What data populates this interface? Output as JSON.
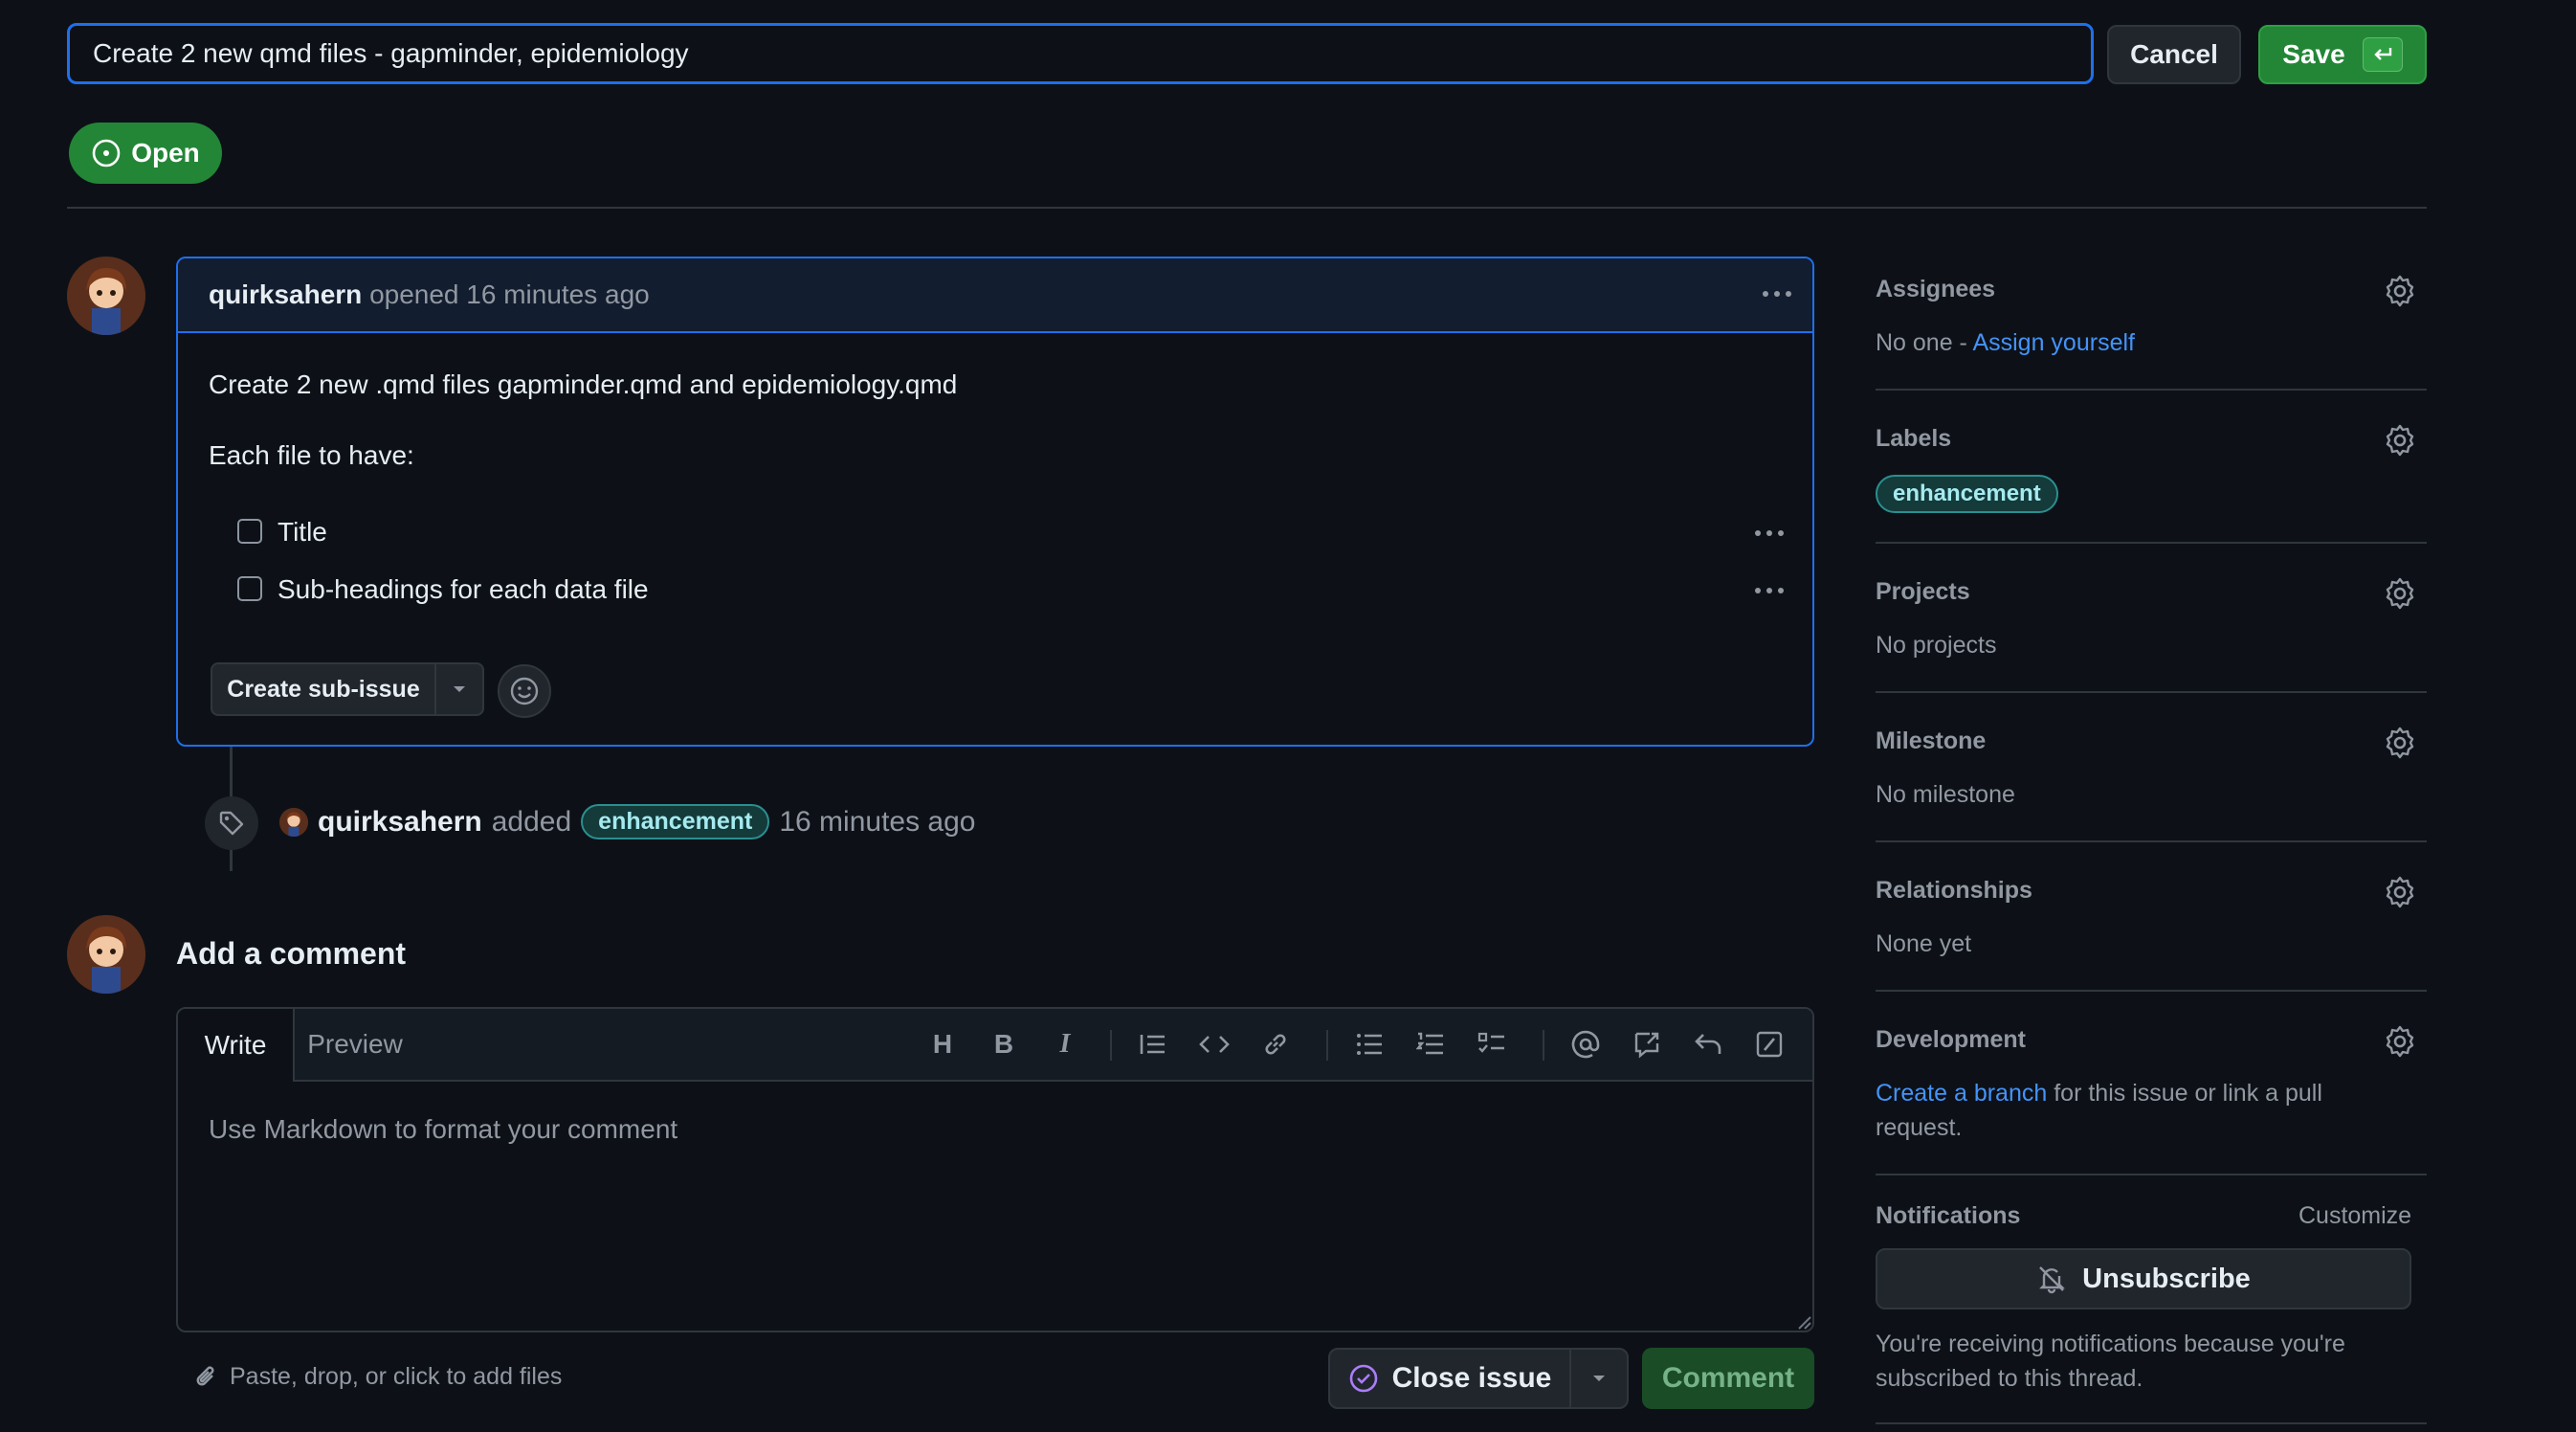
{
  "title_edit": {
    "value": "Create 2 new qmd files - gapminder, epidemiology",
    "cancel_label": "Cancel",
    "save_label": "Save"
  },
  "state": {
    "label": "Open"
  },
  "issue": {
    "author": "quirksahern",
    "opened_text": "opened 16 minutes ago",
    "body_line1": "Create 2 new .qmd files gapminder.qmd and epidemiology.qmd",
    "body_line2": "Each file to have:",
    "tasks": [
      "Title",
      "Sub-headings for each data file"
    ],
    "create_sub_issue_label": "Create sub-issue"
  },
  "timeline": {
    "user": "quirksahern",
    "action": "added",
    "label": "enhancement",
    "time": "16 minutes ago"
  },
  "add_comment": {
    "heading": "Add a comment",
    "tab_write": "Write",
    "tab_preview": "Preview",
    "placeholder": "Use Markdown to format your comment",
    "attach_text": "Paste, drop, or click to add files",
    "close_issue_label": "Close issue",
    "comment_label": "Comment"
  },
  "sidebar": {
    "assignees": {
      "heading": "Assignees",
      "value_prefix": "No one - ",
      "link": "Assign yourself"
    },
    "labels": {
      "heading": "Labels",
      "value": "enhancement"
    },
    "projects": {
      "heading": "Projects",
      "value": "No projects"
    },
    "milestone": {
      "heading": "Milestone",
      "value": "No milestone"
    },
    "relationships": {
      "heading": "Relationships",
      "value": "None yet"
    },
    "development": {
      "heading": "Development",
      "link": "Create a branch",
      "text_line1": " for this issue or link a pull",
      "text_line2": "request."
    },
    "notifications": {
      "heading": "Notifications",
      "customize": "Customize",
      "unsubscribe": "Unsubscribe",
      "reason_line1": "You're receiving notifications because you're",
      "reason_line2": "subscribed to this thread."
    }
  },
  "colors": {
    "background": "#0d1117",
    "accent_blue": "#1f6feb",
    "success_green": "#238636",
    "label_teal": "#2a8f8f"
  }
}
